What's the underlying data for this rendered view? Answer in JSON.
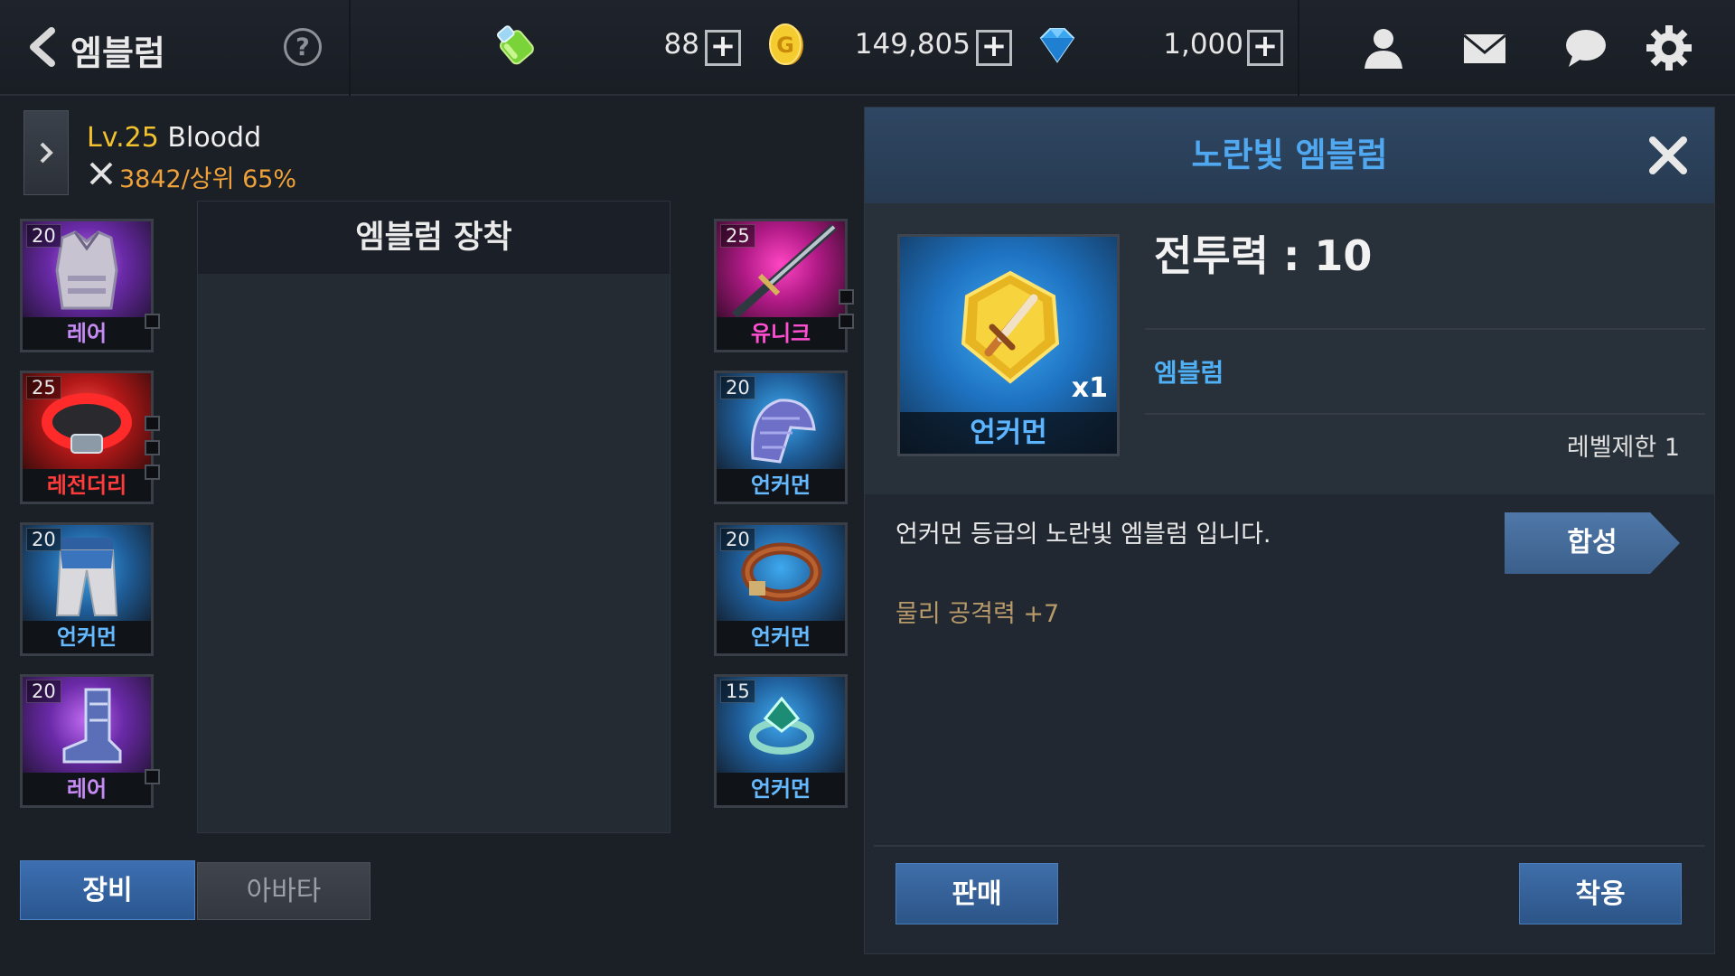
{
  "header": {
    "title": "엠블럼",
    "help": "?",
    "resources": [
      {
        "icon": "green-potion-icon",
        "value": "88"
      },
      {
        "icon": "gold-coin-icon",
        "value": "149,805"
      },
      {
        "icon": "blue-diamond-icon",
        "value": "1,000"
      }
    ],
    "plus": "+",
    "icons": [
      "friends-icon",
      "mail-icon",
      "chat-icon",
      "settings-gear-icon"
    ]
  },
  "player": {
    "level_prefix": "Lv.25",
    "name": "Bloodd",
    "power": "3842/상위 65%"
  },
  "left_slots": [
    {
      "level": "20",
      "grade": "레어",
      "item": "chest-armor"
    },
    {
      "level": "25",
      "grade": "레전더리",
      "item": "red-belt"
    },
    {
      "level": "20",
      "grade": "언커먼",
      "item": "pants"
    },
    {
      "level": "20",
      "grade": "레어",
      "item": "boots"
    }
  ],
  "right_slots": [
    {
      "level": "25",
      "grade": "유니크",
      "item": "katana"
    },
    {
      "level": "20",
      "grade": "언커먼",
      "item": "shoulder-guard"
    },
    {
      "level": "20",
      "grade": "언커먼",
      "item": "collar"
    },
    {
      "level": "15",
      "grade": "언커먼",
      "item": "ring"
    }
  ],
  "emblem_panel": {
    "title": "엠블럼 장착"
  },
  "tabs": {
    "equip": "장비",
    "avatar": "아바타"
  },
  "detail": {
    "title": "노란빛 엠블럼",
    "quantity": "x1",
    "grade": "언커먼",
    "combat_power": "전투력 : 10",
    "type": "엠블럼",
    "level_limit": "레벨제한 1",
    "description": "언커먼 등급의 노란빛 엠블럼 입니다.",
    "stat": "물리 공격력 +7",
    "synth_label": "합성",
    "sell_label": "판매",
    "use_label": "착용"
  },
  "colors": {
    "accent_blue": "#4fa8f0",
    "gold": "#f2c22e",
    "legendary": "#ff3b3b",
    "rare": "#c58af4",
    "unique": "#ff4ed1",
    "uncommon": "#64b9ff"
  }
}
